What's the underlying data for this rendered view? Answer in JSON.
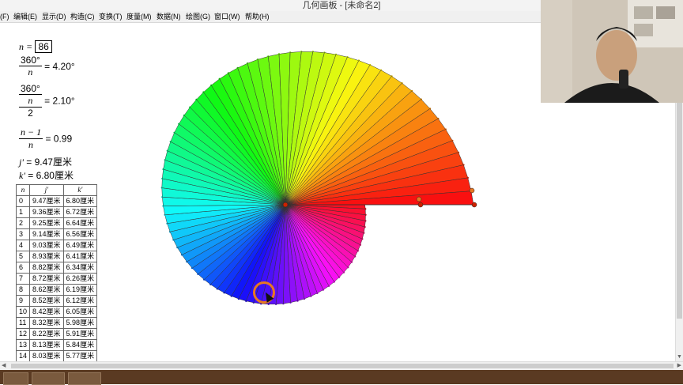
{
  "window": {
    "title": "几何画板 - [未命名2]"
  },
  "menu": [
    {
      "label": "(F)"
    },
    {
      "label": "编辑(E)"
    },
    {
      "label": "显示(D)"
    },
    {
      "label": "构造(C)"
    },
    {
      "label": "变换(T)"
    },
    {
      "label": "度量(M)"
    },
    {
      "label": "数据(N)"
    },
    {
      "label": "绘图(G)"
    },
    {
      "label": "窗口(W)"
    },
    {
      "label": "帮助(H)"
    }
  ],
  "params": {
    "n_label": "n =",
    "n_value": "86",
    "f1_num": "360°",
    "f1_den": "n",
    "f1_val": "= 4.20°",
    "f2_num": "360°",
    "f2_mid": "n",
    "f2_den": "2",
    "f2_val": "= 2.10°",
    "f3_num": "n − 1",
    "f3_den": "n",
    "f3_val": "= 0.99",
    "j_name": "j'",
    "j_val": "= 9.47厘米",
    "k_name": "k'",
    "k_val": "= 6.80厘米"
  },
  "table": {
    "headers": [
      "n",
      "j'",
      "k'"
    ],
    "rows": [
      [
        "0",
        "9.47厘米",
        "6.80厘米"
      ],
      [
        "1",
        "9.36厘米",
        "6.72厘米"
      ],
      [
        "2",
        "9.25厘米",
        "6.64厘米"
      ],
      [
        "3",
        "9.14厘米",
        "6.56厘米"
      ],
      [
        "4",
        "9.03厘米",
        "6.49厘米"
      ],
      [
        "5",
        "8.93厘米",
        "6.41厘米"
      ],
      [
        "6",
        "8.82厘米",
        "6.34厘米"
      ],
      [
        "7",
        "8.72厘米",
        "6.26厘米"
      ],
      [
        "8",
        "8.62厘米",
        "6.19厘米"
      ],
      [
        "9",
        "8.52厘米",
        "6.12厘米"
      ],
      [
        "10",
        "8.42厘米",
        "6.05厘米"
      ],
      [
        "11",
        "8.32厘米",
        "5.98厘米"
      ],
      [
        "12",
        "8.22厘米",
        "5.91厘米"
      ],
      [
        "13",
        "8.13厘米",
        "5.84厘米"
      ],
      [
        "14",
        "8.03厘米",
        "5.77厘米"
      ]
    ]
  },
  "figure": {
    "shape": "rainbow spiral of triangles",
    "count": 86,
    "ratio": 0.99,
    "angle_step_deg": 4.2,
    "colors": {
      "stroke": "#333333",
      "points": "#cc2200",
      "control_points": "#e87722"
    }
  },
  "colors": {
    "accent": "#e87722"
  }
}
